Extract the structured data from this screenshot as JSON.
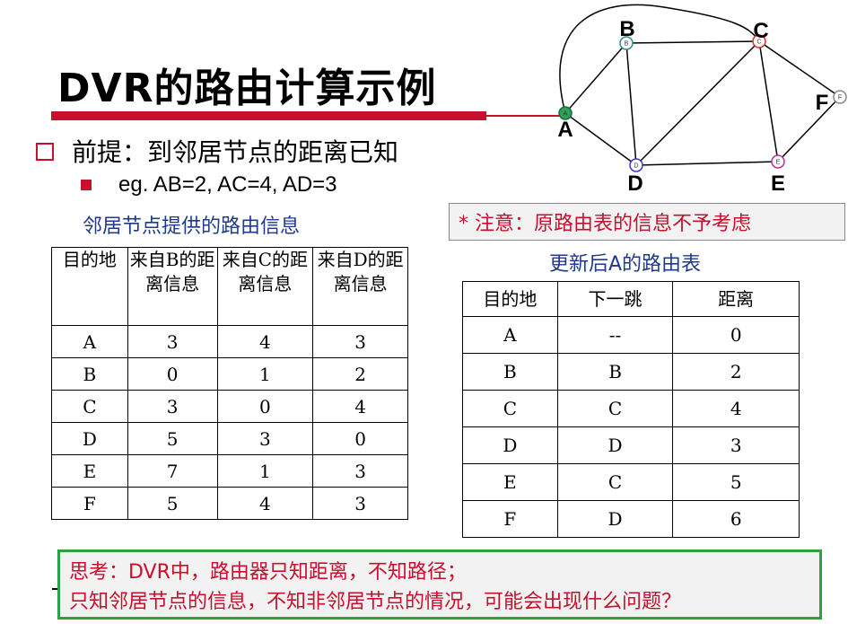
{
  "title": "DVR的路由计算示例",
  "premise": "前提：到邻居节点的距离已知",
  "example": "eg. AB=2, AC=4, AD=3",
  "left_caption": "邻居节点提供的路由信息",
  "note": "* 注意：原路由表的信息不予考虑",
  "right_caption": "更新后A的路由表",
  "left_table": {
    "headers": [
      "目的地",
      "来自B的距离信息",
      "来自C的距离信息",
      "来自D的距离信息"
    ],
    "rows": [
      [
        "A",
        "3",
        "4",
        "3"
      ],
      [
        "B",
        "0",
        "1",
        "2"
      ],
      [
        "C",
        "3",
        "0",
        "4"
      ],
      [
        "D",
        "5",
        "3",
        "0"
      ],
      [
        "E",
        "7",
        "1",
        "3"
      ],
      [
        "F",
        "5",
        "4",
        "3"
      ]
    ]
  },
  "right_table": {
    "headers": [
      "目的地",
      "下一跳",
      "距离"
    ],
    "rows": [
      [
        "A",
        "--",
        "0"
      ],
      [
        "B",
        "B",
        "2"
      ],
      [
        "C",
        "C",
        "4"
      ],
      [
        "D",
        "D",
        "3"
      ],
      [
        "E",
        "C",
        "5"
      ],
      [
        "F",
        "D",
        "6"
      ]
    ]
  },
  "think": {
    "line1": "思考：DVR中，路由器只知距离，不知路径；",
    "line2": "只知邻居节点的信息，不知非邻居节点的情况，可能会出现什么问题？"
  },
  "graph": {
    "nodes": [
      {
        "id": "A",
        "label": "A",
        "small": "A",
        "fill": "#2e9e5b",
        "stroke": "#1e6b3d"
      },
      {
        "id": "B",
        "label": "B",
        "small": "B",
        "fill": "#ffffff",
        "stroke": "#2e8b8b"
      },
      {
        "id": "C",
        "label": "C",
        "small": "C",
        "fill": "#ffffff",
        "stroke": "#d93030"
      },
      {
        "id": "D",
        "label": "D",
        "small": "D",
        "fill": "#ffffff",
        "stroke": "#3b3bb8"
      },
      {
        "id": "E",
        "label": "E",
        "small": "E",
        "fill": "#ffffff",
        "stroke": "#c0309a"
      },
      {
        "id": "F",
        "label": "F",
        "small": "F",
        "fill": "#ffffff",
        "stroke": "#888888"
      }
    ],
    "edges": [
      [
        "A",
        "B"
      ],
      [
        "A",
        "D"
      ],
      [
        "B",
        "D"
      ],
      [
        "B",
        "C"
      ],
      [
        "C",
        "D"
      ],
      [
        "C",
        "E"
      ],
      [
        "D",
        "E"
      ],
      [
        "E",
        "F"
      ],
      [
        "C",
        "F"
      ],
      [
        "A",
        "C"
      ]
    ]
  }
}
